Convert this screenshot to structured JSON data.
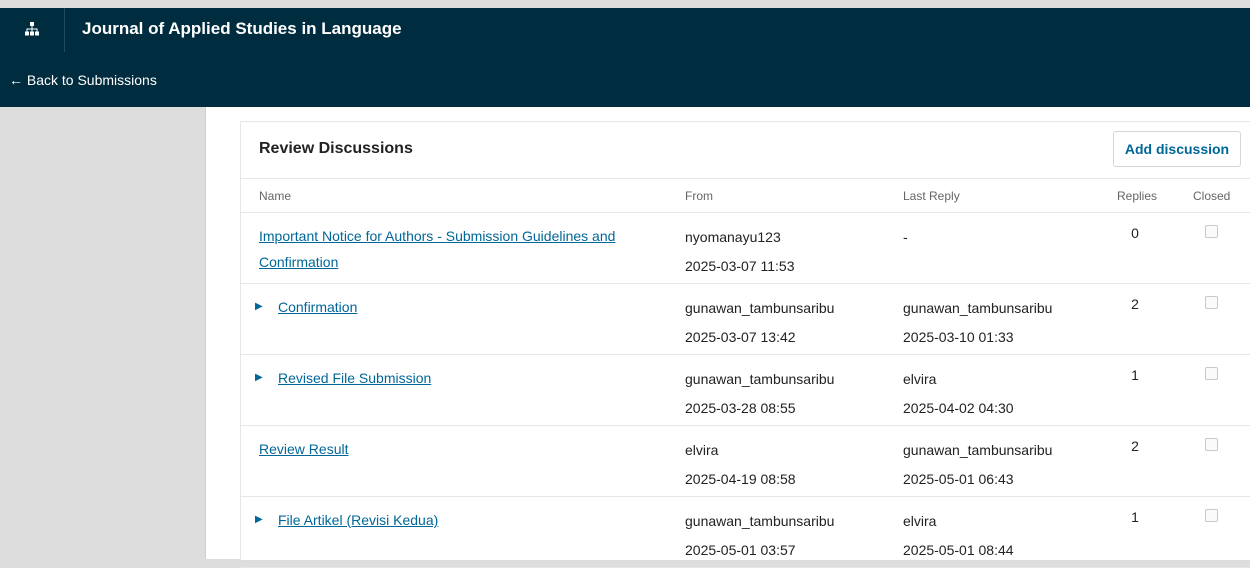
{
  "header": {
    "journal_title": "Journal of Applied Studies in Language",
    "back_label": "← Back to Submissions"
  },
  "panel": {
    "title": "Review Discussions",
    "add_label": "Add discussion",
    "columns": {
      "name": "Name",
      "from": "From",
      "last_reply": "Last Reply",
      "replies": "Replies",
      "closed": "Closed"
    }
  },
  "discussions": [
    {
      "name": "Important Notice for Authors - Submission Guidelines and Confirmation",
      "expandable": false,
      "from_user": "nyomanayu123",
      "from_date": "2025-03-07 11:53",
      "reply_user": "-",
      "reply_date": "",
      "replies": "0",
      "closed": false
    },
    {
      "name": "Confirmation",
      "expandable": true,
      "from_user": "gunawan_tambunsaribu",
      "from_date": "2025-03-07 13:42",
      "reply_user": "gunawan_tambunsaribu",
      "reply_date": "2025-03-10 01:33",
      "replies": "2",
      "closed": false
    },
    {
      "name": "Revised File Submission",
      "expandable": true,
      "from_user": "gunawan_tambunsaribu",
      "from_date": "2025-03-28 08:55",
      "reply_user": "elvira",
      "reply_date": "2025-04-02 04:30",
      "replies": "1",
      "closed": false
    },
    {
      "name": "Review Result",
      "expandable": false,
      "from_user": "elvira",
      "from_date": "2025-04-19 08:58",
      "reply_user": "gunawan_tambunsaribu",
      "reply_date": "2025-05-01 06:43",
      "replies": "2",
      "closed": false
    },
    {
      "name": "File Artikel (Revisi Kedua)",
      "expandable": true,
      "from_user": "gunawan_tambunsaribu",
      "from_date": "2025-05-01 03:57",
      "reply_user": "elvira",
      "reply_date": "2025-05-01 08:44",
      "replies": "1",
      "closed": false
    }
  ],
  "colors": {
    "header_bg": "#002c3f",
    "link": "#006798"
  }
}
